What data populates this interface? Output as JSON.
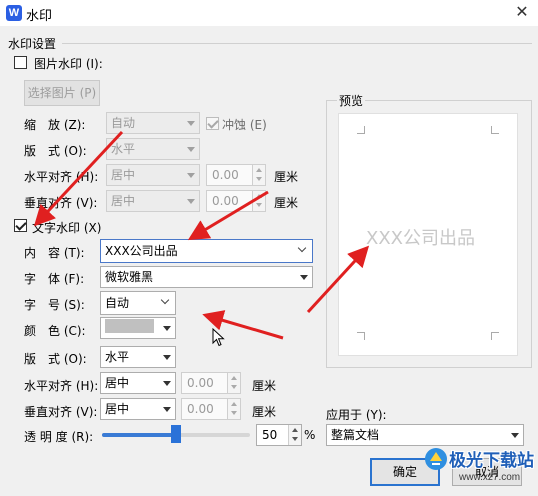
{
  "window": {
    "title": "水印",
    "app_icon_letter": "W"
  },
  "group_title": "水印设置",
  "picture_watermark": {
    "label": "图片水印 (I):",
    "checked": false,
    "select_button": "选择图片 (P)",
    "scale": {
      "label": "缩　放 (Z):",
      "value": "自动"
    },
    "washout": {
      "label": "冲蚀 (E)",
      "checked": true
    },
    "layout": {
      "label": "版　式 (O):",
      "value": "水平"
    },
    "h_align": {
      "label": "水平对齐 (H):",
      "value": "居中",
      "offset": "0.00",
      "unit": "厘米"
    },
    "v_align": {
      "label": "垂直对齐 (V):",
      "value": "居中",
      "offset": "0.00",
      "unit": "厘米"
    }
  },
  "text_watermark": {
    "label": "文字水印 (X)",
    "checked": true,
    "content": {
      "label": "内　容 (T):",
      "value": "XXX公司出品"
    },
    "font": {
      "label": "字　体 (F):",
      "value": "微软雅黑"
    },
    "size": {
      "label": "字　号 (S):",
      "value": "自动"
    },
    "color": {
      "label": "颜　色 (C):",
      "value": "#c0c0c0"
    },
    "layout": {
      "label": "版　式 (O):",
      "value": "水平"
    },
    "h_align": {
      "label": "水平对齐 (H):",
      "value": "居中",
      "offset": "0.00",
      "unit": "厘米"
    },
    "v_align": {
      "label": "垂直对齐 (V):",
      "value": "居中",
      "offset": "0.00",
      "unit": "厘米"
    },
    "transparency": {
      "label": "透 明 度 (R):",
      "value": "50",
      "percent": 50,
      "unit": "%"
    }
  },
  "preview": {
    "label": "预览",
    "watermark_text": "XXX公司出品"
  },
  "apply_to": {
    "label": "应用于 (Y):",
    "value": "整篇文档"
  },
  "buttons": {
    "ok": "确定",
    "cancel": "取消"
  },
  "site_logo": {
    "text": "极光下载站",
    "url": "www.xz7.com"
  },
  "colors": {
    "accent": "#2a72d8",
    "annotation_arrow": "#e02020"
  }
}
